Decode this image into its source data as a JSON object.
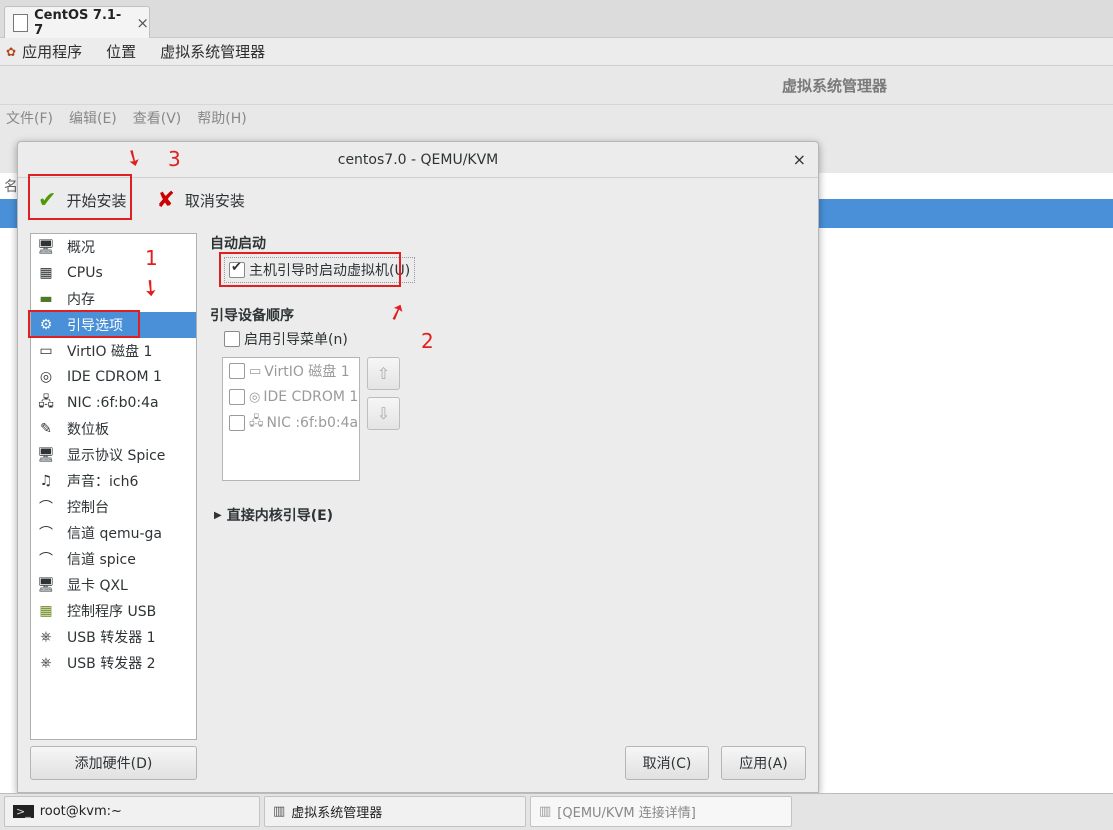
{
  "tab": {
    "title": "CentOS 7.1-7",
    "close": "×"
  },
  "topmenu": {
    "apps": "应用程序",
    "places": "位置",
    "vmm": "虚拟系统管理器"
  },
  "mainwin": {
    "title": "虚拟系统管理器",
    "menu": [
      "文件(F)",
      "编辑(E)",
      "查看(V)",
      "帮助(H)"
    ],
    "col_head": "名"
  },
  "dialog": {
    "title": "centos7.0 - QEMU/KVM",
    "close": "×",
    "toolbar": {
      "start": "开始安装",
      "cancel": "取消安装"
    },
    "hw_items": [
      {
        "label": "概况",
        "icon": "monitor-icon"
      },
      {
        "label": "CPUs",
        "icon": "cpu-icon"
      },
      {
        "label": "内存",
        "icon": "memory-icon"
      },
      {
        "label": "引导选项",
        "icon": "boot-options-icon"
      },
      {
        "label": "VirtIO 磁盘 1",
        "icon": "disk-icon"
      },
      {
        "label": "IDE CDROM 1",
        "icon": "cdrom-icon"
      },
      {
        "label": "NIC :6f:b0:4a",
        "icon": "network-icon"
      },
      {
        "label": "数位板",
        "icon": "tablet-icon"
      },
      {
        "label": "显示协议 Spice",
        "icon": "display-icon"
      },
      {
        "label": "声音：ich6",
        "icon": "sound-icon"
      },
      {
        "label": "控制台",
        "icon": "serial-icon"
      },
      {
        "label": "信道 qemu-ga",
        "icon": "channel-icon"
      },
      {
        "label": "信道 spice",
        "icon": "channel-icon"
      },
      {
        "label": "显卡 QXL",
        "icon": "video-card-icon"
      },
      {
        "label": "控制程序 USB",
        "icon": "controller-icon"
      },
      {
        "label": "USB 转发器 1",
        "icon": "usb-icon"
      },
      {
        "label": "USB 转发器 2",
        "icon": "usb-icon"
      }
    ],
    "add_hw": "添加硬件(D)",
    "autostart": {
      "title": "自动启动",
      "checkbox": "主机引导时启动虚拟机(U)",
      "checked": true
    },
    "bootorder": {
      "title": "引导设备顺序",
      "menu_checkbox": "启用引导菜单(n)",
      "devices": [
        "VirtIO 磁盘 1",
        "IDE CDROM 1",
        "NIC :6f:b0:4a"
      ]
    },
    "kernel": "直接内核引导(E)",
    "buttons": {
      "cancel": "取消(C)",
      "apply": "应用(A)"
    }
  },
  "annotations": {
    "n1": "1",
    "n2": "2",
    "n3": "3"
  },
  "taskbar": [
    {
      "label": "root@kvm:~",
      "icon": "terminal-icon"
    },
    {
      "label": "虚拟系统管理器",
      "icon": "vmm-icon"
    },
    {
      "label": "[QEMU/KVM 连接详情]",
      "icon": "vmm-icon"
    }
  ]
}
